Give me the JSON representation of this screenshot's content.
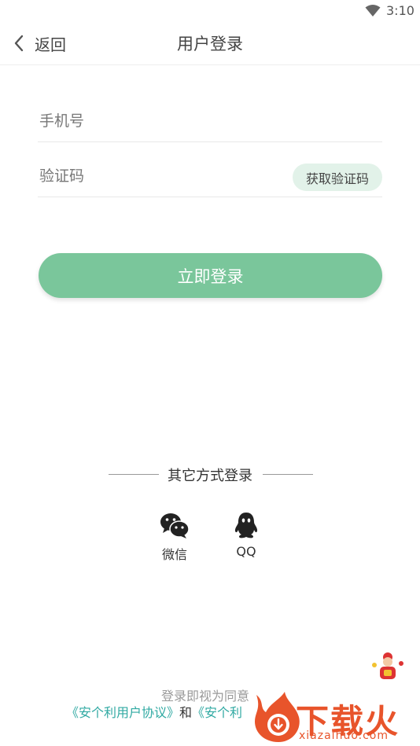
{
  "status_bar": {
    "time": "3:10"
  },
  "nav": {
    "back_label": "返回",
    "title": "用户登录"
  },
  "form": {
    "phone_placeholder": "手机号",
    "code_placeholder": "验证码",
    "get_code_label": "获取验证码",
    "login_label": "立即登录"
  },
  "other_login": {
    "title": "其它方式登录",
    "options": [
      {
        "label": "微信",
        "icon": "wechat-icon"
      },
      {
        "label": "QQ",
        "icon": "qq-icon"
      }
    ]
  },
  "agreement": {
    "line1": "登录即视为同意",
    "link1": "《安个利用户协议》",
    "connector": "和",
    "link2": "《安个利"
  },
  "watermark": {
    "brand": "下载火",
    "url": "xiazaihuo.com"
  },
  "colors": {
    "accent": "#7ac69b",
    "code_button_bg": "#e2f2e9",
    "link": "#2fa9a2",
    "watermark": "#e8542b"
  }
}
